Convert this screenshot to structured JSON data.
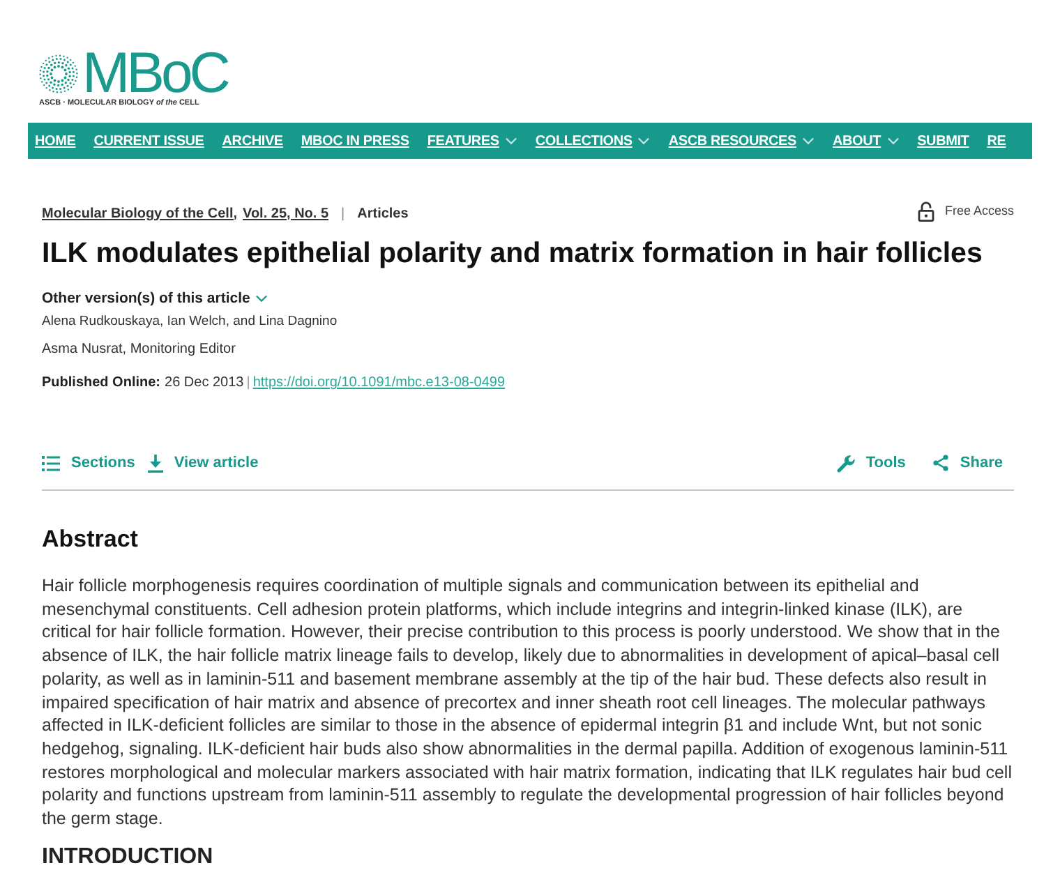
{
  "logo": {
    "wordmark": "MBoC",
    "tagline": "ASCB · MOLECULAR BIOLOGY *of the* CELL"
  },
  "nav": [
    {
      "label": "HOME",
      "has_menu": false
    },
    {
      "label": "CURRENT ISSUE",
      "has_menu": false
    },
    {
      "label": "ARCHIVE",
      "has_menu": false
    },
    {
      "label": "MBOC IN PRESS",
      "has_menu": false
    },
    {
      "label": "FEATURES",
      "has_menu": true
    },
    {
      "label": "COLLECTIONS",
      "has_menu": true
    },
    {
      "label": "ASCB RESOURCES",
      "has_menu": true
    },
    {
      "label": "ABOUT",
      "has_menu": true
    },
    {
      "label": "SUBMIT",
      "has_menu": false
    },
    {
      "label": "RE",
      "has_menu": false
    }
  ],
  "breadcrumb": {
    "journal": "Molecular Biology of the Cell,",
    "issue": "Vol. 25, No. 5",
    "separator": "|",
    "section": "Articles"
  },
  "access": {
    "label": "Free Access"
  },
  "article": {
    "title": "ILK modulates epithelial polarity and matrix formation in hair follicles",
    "other_versions": {
      "label": "Other version(s) of this article",
      "expanded": false
    },
    "authors": "Alena Rudkouskaya, Ian Welch, and Lina Dagnino",
    "editor": "Asma Nusrat, Monitoring Editor",
    "published": {
      "label": "Published Online:",
      "date": "26 Dec 2013",
      "separator": "|",
      "doi": "https://doi.org/10.1091/mbc.e13-08-0499"
    }
  },
  "toolbar": {
    "left": [
      {
        "label": "Sections",
        "kind": "list"
      },
      {
        "label": "View article",
        "kind": "download"
      }
    ],
    "right": [
      {
        "label": "Tools",
        "kind": "wrench"
      },
      {
        "label": "Share",
        "kind": "share"
      }
    ]
  },
  "abstract": {
    "heading": "Abstract",
    "text": "Hair follicle morphogenesis requires coordination of multiple signals and communication between its epithelial and mesenchymal constituents. Cell adhesion protein platforms, which include integrins and integrin-linked kinase (ILK), are critical for hair follicle formation. However, their precise contribution to this process is poorly understood. We show that in the absence of ILK, the hair follicle matrix lineage fails to develop, likely due to abnormalities in development of apical–basal cell polarity, as well as in laminin-511 and basement membrane assembly at the tip of the hair bud. These defects also result in impaired specification of hair matrix and absence of precortex and inner sheath root cell lineages. The molecular pathways affected in ILK-deficient follicles are similar to those in the absence of epidermal integrin β1 and include Wnt, but not sonic hedgehog, signaling. ILK-deficient hair buds also show abnormalities in the dermal papilla. Addition of exogenous laminin-511 restores morphological and molecular markers associated with hair matrix formation, indicating that ILK regulates hair bud cell polarity and functions upstream from laminin-511 assembly to regulate the developmental progression of hair follicles beyond the germ stage."
  },
  "next_section": {
    "heading": "INTRODUCTION"
  }
}
